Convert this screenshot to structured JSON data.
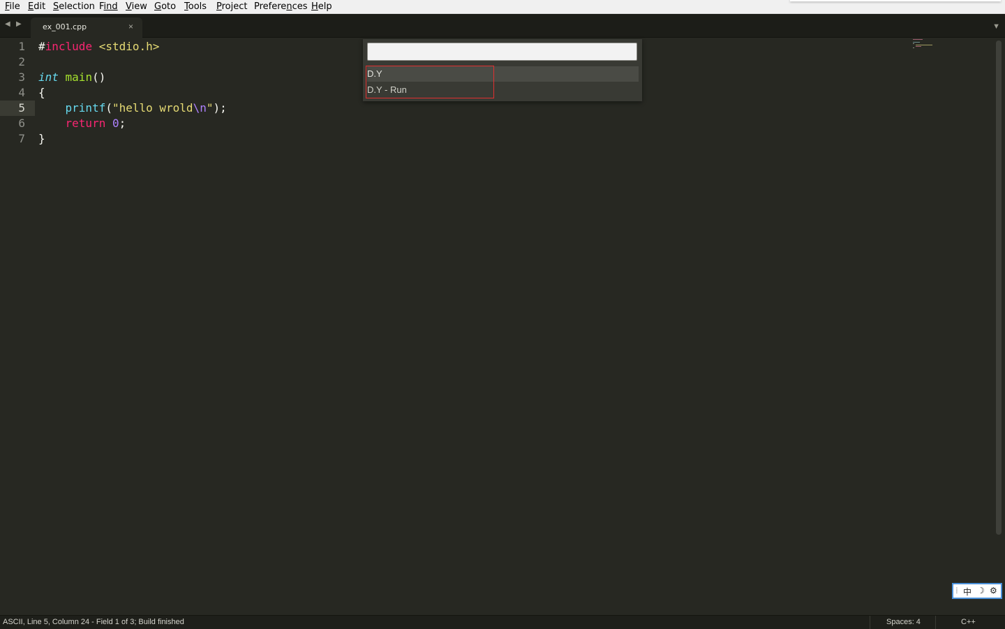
{
  "menubar": {
    "items": [
      {
        "accel": "F",
        "rest": "ile"
      },
      {
        "accel": "E",
        "rest": "dit"
      },
      {
        "accel": "S",
        "rest": "election"
      },
      {
        "accel": "F",
        "rest": "ind",
        "underline_first": false
      },
      {
        "accel": "V",
        "rest": "iew"
      },
      {
        "accel": "G",
        "rest": "oto"
      },
      {
        "accel": "T",
        "rest": "ools"
      },
      {
        "accel": "P",
        "rest": "roject"
      },
      {
        "pre": "Prefere",
        "accel": "n",
        "rest": "ces"
      },
      {
        "accel": "H",
        "rest": "elp"
      }
    ]
  },
  "tabs": {
    "active_file": "ex_001.cpp",
    "close_glyph": "×",
    "back_glyph": "◀",
    "forward_glyph": "▶",
    "overflow_glyph": "▼"
  },
  "editor": {
    "line_numbers": [
      "1",
      "2",
      "3",
      "4",
      "5",
      "6",
      "7"
    ],
    "current_line": "5",
    "lines": {
      "l1_hash": "#",
      "l1_kw": "include",
      "l1_header": " <stdio.h>",
      "l3_type": "int",
      "l3_fn": " main",
      "l3_rest": "()",
      "l4": "{",
      "l5_indent": "    ",
      "l5_fn": "printf",
      "l5_open": "(",
      "l5_str": "\"hello wrold",
      "l5_esc": "\\n",
      "l5_strend": "\"",
      "l5_close": ");",
      "l6_indent": "    ",
      "l6_kw": "return",
      "l6_sp": " ",
      "l6_num": "0",
      "l6_end": ";",
      "l7": "}"
    }
  },
  "palette": {
    "input_value": "",
    "items": [
      "D.Y",
      "D.Y - Run"
    ]
  },
  "ime": {
    "handle": "⁞",
    "mode": "中",
    "punct": "☽",
    "settings": "⚙"
  },
  "statusbar": {
    "text": "ASCII, Line 5, Column 24 - Field 1 of 3; Build finished",
    "indentation": "Spaces: 4",
    "syntax": "C++"
  },
  "colors": {
    "editor_bg": "#272822",
    "keyword": "#f92672",
    "function": "#a6e22e",
    "string": "#e6db74",
    "number": "#ae81ff",
    "highlight_border": "#e03030"
  }
}
